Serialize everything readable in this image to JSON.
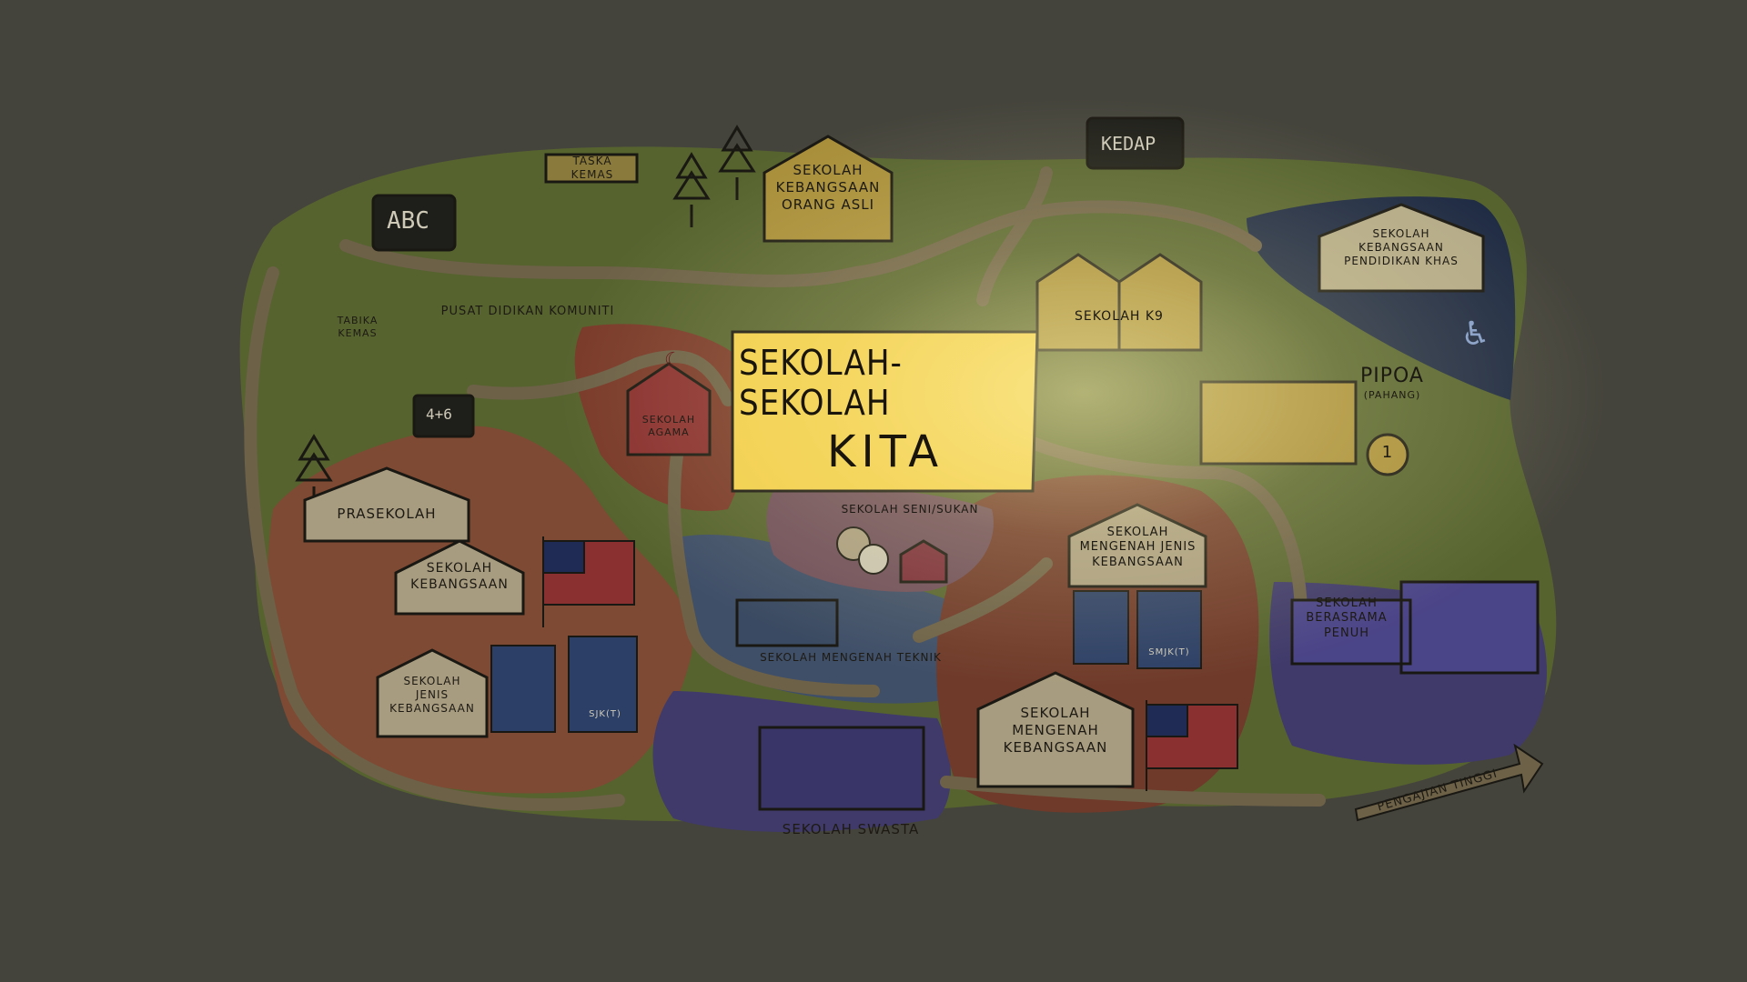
{
  "title": {
    "line1": "SEKOLAH-SEKOLAH",
    "line2": "KITA"
  },
  "places": {
    "taska_kemas": "TASKA\nKEMAS",
    "sk_orang_asli": "SEKOLAH\nKEBANGSAAN\nORANG ASLI",
    "kedap": "KEDAP",
    "sk_pendidikan_khas": "SEKOLAH\nKEBANGSAAN\nPENDIDIKAN KHAS",
    "tabika_kemas": "TABIKA\nKEMAS",
    "pusat_didikan": "PUSAT DIDIKAN KOMUNITI",
    "sekolah_k9": "SEKOLAH K9",
    "pipoa": "PIPOA",
    "pipoa_sub": "(PAHANG)",
    "sekolah_agama": "SEKOLAH\nAGAMA",
    "prasekolah": "PRASEKOLAH",
    "seni_sukan": "SEKOLAH SENI/SUKAN",
    "sk": "SEKOLAH\nKEBANGSAAN",
    "smjk": "SEKOLAH\nMENGENAH JENIS\nKEBANGSAAN",
    "sjk": "SEKOLAH\nJENIS\nKEBANGSAAN",
    "teknik": "SEKOLAH MENGENAH TEKNIK",
    "sbp": "SEKOLAH\nBERASRAMA\nPENUH",
    "smk": "SEKOLAH\nMENGENAH\nKEBANGSAAN",
    "swasta": "SEKOLAH SWASTA",
    "pengajian_tinggi": "PENGAJIAN TINGGI"
  },
  "chalk": {
    "abc": "ABC",
    "math": "4+6"
  },
  "book_labels": {
    "sjkt": "SJK(T)",
    "smjkt": "SMJK(T)"
  },
  "medal_number": "1",
  "colors": {
    "background": "#45443c",
    "green": "#56632f",
    "terracotta": "#7e4a33",
    "red": "#7a3a2a",
    "blue": "#3f4f68",
    "navy": "#1f2b44",
    "purple": "#3f3a6a",
    "road": "#6d6148",
    "title_yellow": "#f2cf4c"
  }
}
